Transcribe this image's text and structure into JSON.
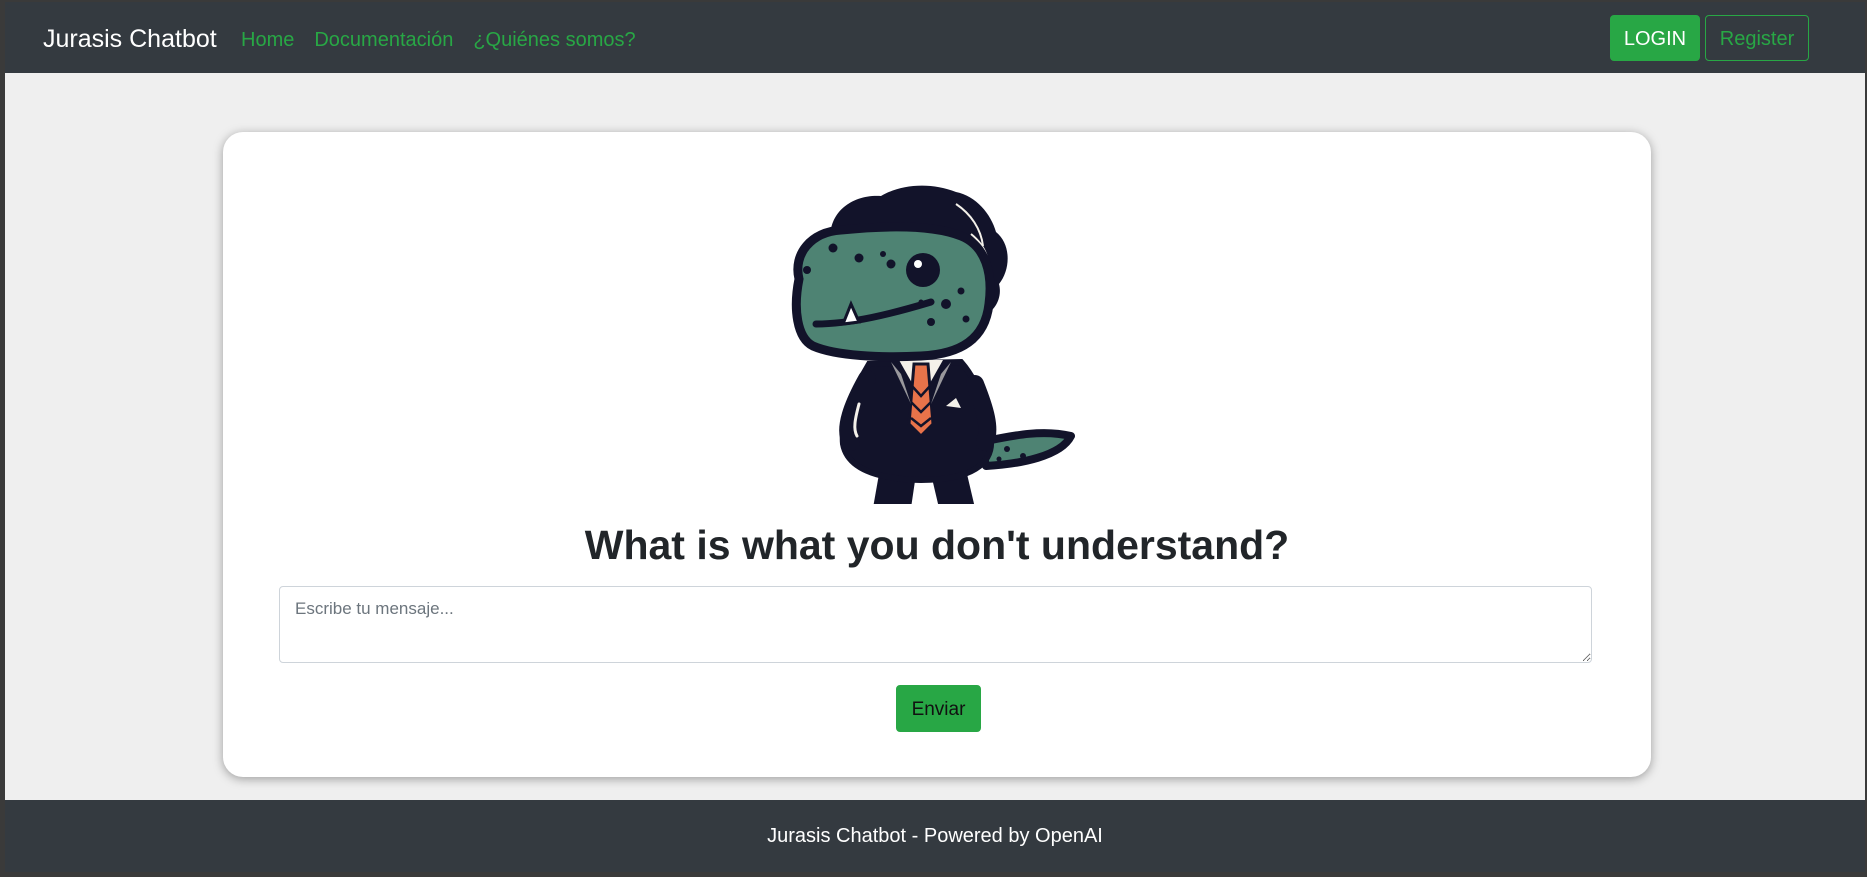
{
  "navbar": {
    "brand": "Jurasis Chatbot",
    "links": [
      {
        "label": "Home"
      },
      {
        "label": "Documentación"
      },
      {
        "label": "¿Quiénes somos?"
      }
    ],
    "login_label": "LOGIN",
    "register_label": "Register"
  },
  "main": {
    "mascot_icon": "dinosaur-in-suit-mascot",
    "title": "What is what you don't understand?",
    "input_placeholder": "Escribe tu mensaje...",
    "send_label": "Enviar"
  },
  "footer": {
    "text": "Jurasis Chatbot - Powered by OpenAI"
  },
  "colors": {
    "navbar_bg": "#343a40",
    "accent_green": "#28a745",
    "page_bg": "#efefef",
    "card_bg": "#ffffff",
    "mascot_skin": "#4e8373",
    "mascot_suit": "#12132a",
    "mascot_tie": "#e8734a"
  }
}
